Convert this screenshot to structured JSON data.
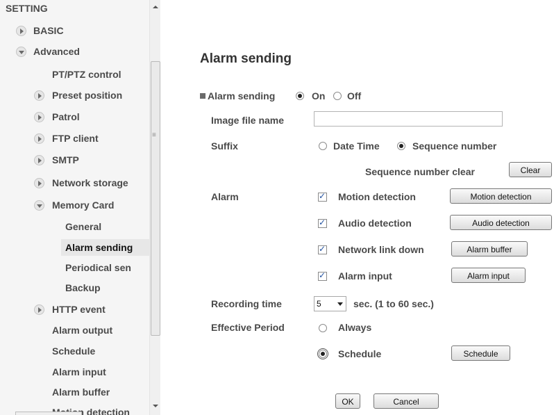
{
  "sidebar": {
    "header": "SETTING",
    "items": [
      {
        "label": "BASIC"
      },
      {
        "label": "Advanced"
      },
      {
        "label": "PT/PTZ control"
      },
      {
        "label": "Preset position"
      },
      {
        "label": "Patrol"
      },
      {
        "label": "FTP client"
      },
      {
        "label": "SMTP"
      },
      {
        "label": "Network storage"
      },
      {
        "label": "Memory Card"
      },
      {
        "label": "General"
      },
      {
        "label": "Alarm sending"
      },
      {
        "label": "Periodical sen"
      },
      {
        "label": "Backup"
      },
      {
        "label": "HTTP event"
      },
      {
        "label": "Alarm output"
      },
      {
        "label": "Schedule"
      },
      {
        "label": "Alarm input"
      },
      {
        "label": "Alarm buffer"
      },
      {
        "label": "Motion detection"
      }
    ]
  },
  "main": {
    "title": "Alarm sending",
    "alarm_sending": {
      "label": "Alarm sending",
      "on": "On",
      "off": "Off",
      "selected": "On"
    },
    "image_file_name": {
      "label": "Image file name",
      "value": ""
    },
    "suffix": {
      "label": "Suffix",
      "date_time": "Date Time",
      "sequence_number": "Sequence number",
      "selected": "Sequence number"
    },
    "sequence_clear": {
      "label": "Sequence number clear",
      "button": "Clear"
    },
    "alarm": {
      "label": "Alarm",
      "rows": [
        {
          "label": "Motion detection",
          "checked": true,
          "button": "Motion detection"
        },
        {
          "label": "Audio detection",
          "checked": true,
          "button": "Audio detection"
        },
        {
          "label": "Network link down",
          "checked": true,
          "button": "Alarm buffer"
        },
        {
          "label": "Alarm input",
          "checked": true,
          "button": "Alarm input"
        }
      ]
    },
    "recording_time": {
      "label": "Recording time",
      "value": "5",
      "suffix": "sec. (1 to 60 sec.)"
    },
    "effective_period": {
      "label": "Effective Period",
      "always": "Always",
      "schedule": "Schedule",
      "schedule_button": "Schedule",
      "selected": "Schedule"
    },
    "ok": "OK",
    "cancel": "Cancel"
  }
}
